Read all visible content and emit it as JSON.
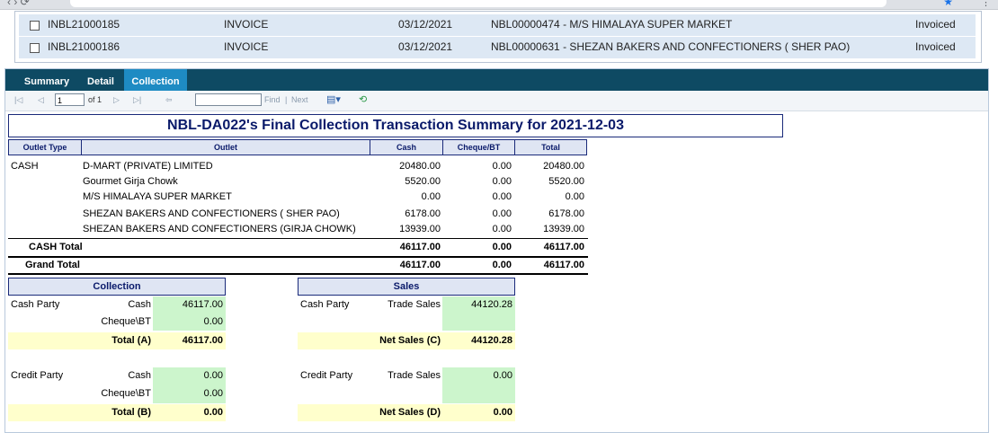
{
  "invoices": [
    {
      "id": "INBL21000185",
      "type": "INVOICE",
      "date": "03/12/2021",
      "party": "NBL00000474 - M/S HIMALAYA SUPER MARKET",
      "status": "Invoiced"
    },
    {
      "id": "INBL21000186",
      "type": "INVOICE",
      "date": "03/12/2021",
      "party": "NBL00000631 - SHEZAN BAKERS AND CONFECTIONERS ( SHER PAO)",
      "status": "Invoiced"
    }
  ],
  "tabs": [
    "Summary",
    "Detail",
    "Collection"
  ],
  "active_tab": "Collection",
  "toolbar": {
    "page": "1",
    "of": "of 1",
    "find": "Find",
    "sep": "|",
    "next": "Next"
  },
  "report_title": "NBL-DA022's  Final Collection Transaction Summary for 2021-12-03",
  "table": {
    "headers": [
      "Outlet Type",
      "Outlet",
      "Cash",
      "Cheque/BT",
      "Total"
    ],
    "group_label": "CASH",
    "rows": [
      {
        "outlet": "D-MART (PRIVATE) LIMITED",
        "cash": "20480.00",
        "cheque": "0.00",
        "total": "20480.00"
      },
      {
        "outlet": "Gourmet Girja Chowk",
        "cash": "5520.00",
        "cheque": "0.00",
        "total": "5520.00"
      },
      {
        "outlet": "M/S HIMALAYA SUPER MARKET",
        "cash": "0.00",
        "cheque": "0.00",
        "total": "0.00"
      },
      {
        "outlet": "SHEZAN BAKERS AND CONFECTIONERS ( SHER PAO)",
        "cash": "6178.00",
        "cheque": "0.00",
        "total": "6178.00"
      },
      {
        "outlet": "SHEZAN BAKERS AND CONFECTIONERS (GIRJA CHOWK)",
        "cash": "13939.00",
        "cheque": "0.00",
        "total": "13939.00"
      }
    ],
    "cash_total": {
      "label": "CASH Total",
      "cash": "46117.00",
      "cheque": "0.00",
      "total": "46117.00"
    },
    "grand_total": {
      "label": "Grand Total",
      "cash": "46117.00",
      "cheque": "0.00",
      "total": "46117.00"
    }
  },
  "collection": {
    "header": "Collection",
    "cash_party": "Cash Party",
    "credit_party": "Credit Party",
    "cash_label": "Cash",
    "cheque_label": "Cheque\\BT",
    "total_a_label": "Total (A)",
    "total_b_label": "Total (B)",
    "cash_party_cash": "46117.00",
    "cash_party_cheque": "0.00",
    "total_a": "46117.00",
    "credit_party_cash": "0.00",
    "credit_party_cheque": "0.00",
    "total_b": "0.00"
  },
  "sales": {
    "header": "Sales",
    "cash_party": "Cash Party",
    "credit_party": "Credit Party",
    "trade_sales_label": "Trade Sales",
    "net_c_label": "Net Sales (C)",
    "net_d_label": "Net Sales (D)",
    "cash_trade_sales": "44120.28",
    "net_c": "44120.28",
    "credit_trade_sales": "0.00",
    "net_d": "0.00"
  }
}
